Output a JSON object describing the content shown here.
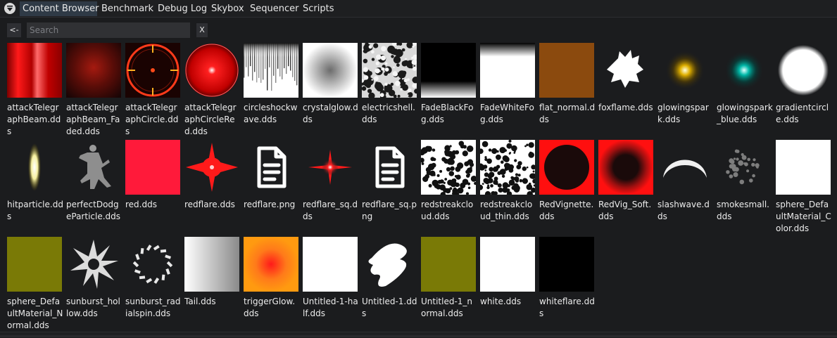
{
  "tabs": [
    {
      "label": "Content Browser",
      "active": true
    },
    {
      "label": "Benchmark",
      "active": false
    },
    {
      "label": "Debug Log",
      "active": false
    },
    {
      "label": "Skybox",
      "active": false
    },
    {
      "label": "Sequencer",
      "active": false
    },
    {
      "label": "Scripts",
      "active": false
    }
  ],
  "toolbar": {
    "back_label": "<-",
    "search_placeholder": "Search",
    "search_value": "",
    "clear_label": "X"
  },
  "colors": {
    "panel_bg": "#1b1c1e",
    "active_tab": "#2f3a46",
    "text": "#e6e6e6"
  },
  "files": [
    {
      "name": "attackTelegraphBeam.dds",
      "icon": "red-beam"
    },
    {
      "name": "attackTelegraphBeam_Faded.dds",
      "icon": "red-beam-faded"
    },
    {
      "name": "attackTelegraphCircle.dds",
      "icon": "red-circle-outline"
    },
    {
      "name": "attackTelegraphCircleRed.dds",
      "icon": "red-circle-glow"
    },
    {
      "name": "circleshockwave.dds",
      "icon": "shockwave-spikes"
    },
    {
      "name": "crystalglow.dds",
      "icon": "gray-radial-glow"
    },
    {
      "name": "electricshell.dds",
      "icon": "electric-noise"
    },
    {
      "name": "FadeBlackFog.dds",
      "icon": "fade-black"
    },
    {
      "name": "FadeWhiteFog.dds",
      "icon": "fade-white"
    },
    {
      "name": "flat_normal.dds",
      "icon": "brown-square"
    },
    {
      "name": "foxflame.dds",
      "icon": "white-flame"
    },
    {
      "name": "glowingspark.dds",
      "icon": "yellow-spark"
    },
    {
      "name": "glowingspark_blue.dds",
      "icon": "teal-spark"
    },
    {
      "name": "gradientcircle.dds",
      "icon": "white-circle"
    },
    {
      "name": "hitparticle.dds",
      "icon": "yellow-ellipse"
    },
    {
      "name": "perfectDodgeParticle.dds",
      "icon": "dancer-figure"
    },
    {
      "name": "red.dds",
      "icon": "red-square"
    },
    {
      "name": "redflare.dds",
      "icon": "red-flare"
    },
    {
      "name": "redflare.png",
      "icon": "document-icon"
    },
    {
      "name": "redflare_sq.dds",
      "icon": "red-flare-small"
    },
    {
      "name": "redflare_sq.png",
      "icon": "document-icon"
    },
    {
      "name": "redstreakcloud.dds",
      "icon": "bw-cloud"
    },
    {
      "name": "redstreakcloud_thin.dds",
      "icon": "bw-cloud-thin"
    },
    {
      "name": "RedVignette.dds",
      "icon": "red-vignette"
    },
    {
      "name": "RedVig_Soft.dds",
      "icon": "red-vignette-soft"
    },
    {
      "name": "slashwave.dds",
      "icon": "white-crescent"
    },
    {
      "name": "smokesmall.dds",
      "icon": "gray-smoke"
    },
    {
      "name": "sphere_DefaultMaterial_Color.dds",
      "icon": "white-square"
    },
    {
      "name": "sphere_DefaultMaterial_Normal.dds",
      "icon": "olive-square"
    },
    {
      "name": "sunburst_hollow.dds",
      "icon": "white-sunburst"
    },
    {
      "name": "sunburst_radialspin.dds",
      "icon": "radial-spin"
    },
    {
      "name": "Tail.dds",
      "icon": "white-gray-gradient"
    },
    {
      "name": "triggerGlow.dds",
      "icon": "orange-glow"
    },
    {
      "name": "Untitled-1-half.dds",
      "icon": "white-square"
    },
    {
      "name": "Untitled-1.dds",
      "icon": "white-brush-strokes"
    },
    {
      "name": "Untitled-1_normal.dds",
      "icon": "olive-square"
    },
    {
      "name": "white.dds",
      "icon": "white-square"
    },
    {
      "name": "whiteflare.dds",
      "icon": "black-square"
    }
  ]
}
